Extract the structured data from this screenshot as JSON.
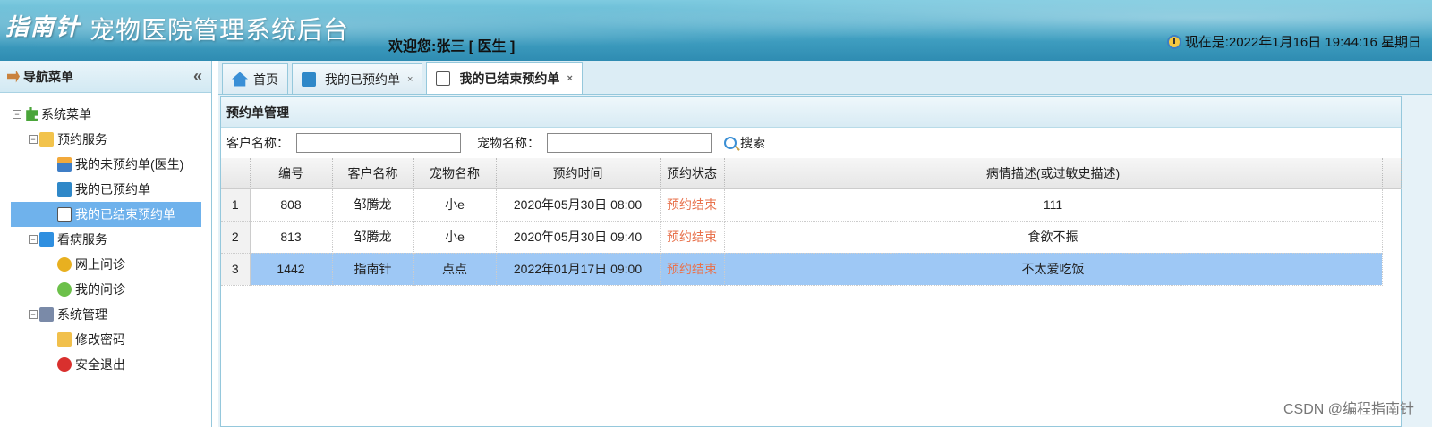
{
  "header": {
    "brand": "指南针",
    "title": "宠物医院管理系统后台",
    "welcome": "欢迎您:张三 [ 医生 ]",
    "datetime": "现在是:2022年1月16日 19:44:16 星期日"
  },
  "sidebar": {
    "title": "导航菜单",
    "collapse": "«",
    "tree": {
      "root": "系统菜单",
      "groups": [
        {
          "label": "预约服务",
          "items": [
            "我的未预约单(医生)",
            "我的已预约单",
            "我的已结束预约单"
          ]
        },
        {
          "label": "看病服务",
          "items": [
            "网上问诊",
            "我的问诊"
          ]
        },
        {
          "label": "系统管理",
          "items": [
            "修改密码",
            "安全退出"
          ]
        }
      ]
    }
  },
  "tabs": [
    {
      "label": "首页"
    },
    {
      "label": "我的已预约单",
      "close": "×"
    },
    {
      "label": "我的已结束预约单",
      "close": "×"
    }
  ],
  "panel": {
    "title": "预约单管理",
    "customer_label": "客户名称：",
    "pet_label": "宠物名称：",
    "customer_value": "",
    "pet_value": "",
    "search_label": "搜索"
  },
  "table": {
    "columns": [
      "编号",
      "客户名称",
      "宠物名称",
      "预约时间",
      "预约状态",
      "病情描述(或过敏史描述)"
    ],
    "rows": [
      {
        "rn": "1",
        "id": "808",
        "customer": "邹腾龙",
        "pet": "小e",
        "time": "2020年05月30日 08:00",
        "status": "预约结束",
        "desc": "111"
      },
      {
        "rn": "2",
        "id": "813",
        "customer": "邹腾龙",
        "pet": "小e",
        "time": "2020年05月30日 09:40",
        "status": "预约结束",
        "desc": "食欲不振"
      },
      {
        "rn": "3",
        "id": "1442",
        "customer": "指南针",
        "pet": "点点",
        "time": "2022年01月17日 09:00",
        "status": "预约结束",
        "desc": "不太爱吃饭"
      }
    ]
  },
  "watermark": "CSDN @编程指南针"
}
